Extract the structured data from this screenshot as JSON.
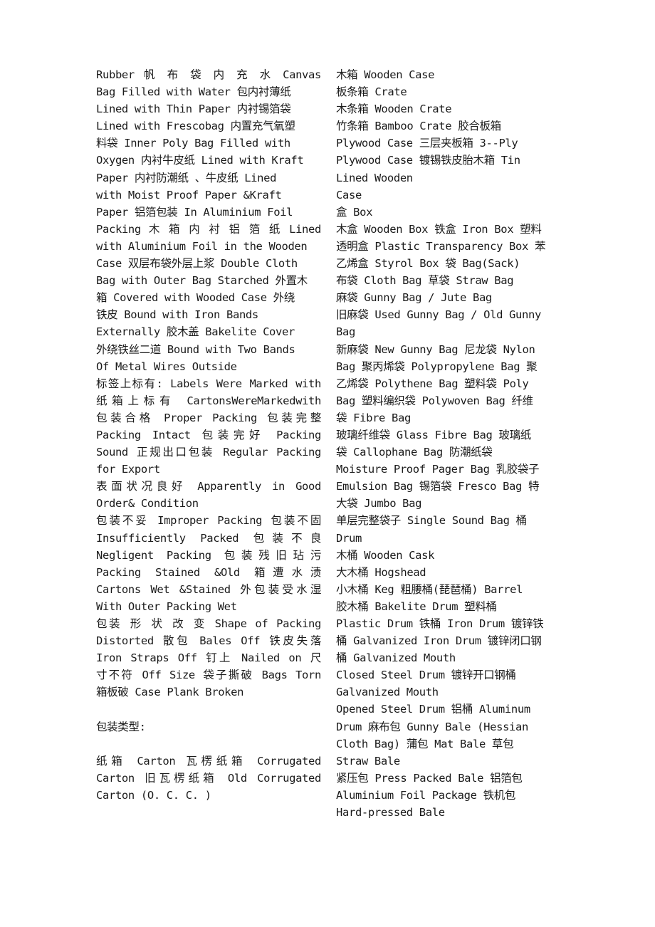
{
  "document": {
    "left_column": {
      "paragraphs": [
        {
          "lines": [
            {
              "text": "Rubber 帆 布 袋 内 充 水 Canvas",
              "justify": true
            },
            {
              "text": "Bag Filled with Water 包内衬薄纸",
              "justify": false
            },
            {
              "text": "Lined with Thin Paper 内衬锡箔袋",
              "justify": false
            },
            {
              "text": "Lined with Frescobag 内置充气氧塑",
              "justify": false
            },
            {
              "text": "料袋 Inner Poly Bag Filled with",
              "justify": false
            },
            {
              "text": "Oxygen 内衬牛皮纸 Lined with Kraft",
              "justify": false
            },
            {
              "text": "Paper 内衬防潮纸 、牛皮纸 Lined",
              "justify": false
            },
            {
              "text": "with Moist Proof Paper &Kraft",
              "justify": false
            },
            {
              "text": "Paper 铝箔包装 In Aluminium Foil",
              "justify": false
            },
            {
              "text": "Packing 木 箱 内 衬 铝 箔 纸 Lined",
              "justify": true
            },
            {
              "text": "with Aluminium Foil in the Wooden",
              "justify": false
            },
            {
              "text": "Case 双层布袋外层上浆 Double Cloth",
              "justify": false
            },
            {
              "text": "Bag with Outer Bag Starched 外置木",
              "justify": false
            },
            {
              "text": "箱 Covered with Wooded Case 外绕",
              "justify": false
            },
            {
              "text": "铁皮 Bound with Iron Bands",
              "justify": false
            },
            {
              "text": "Externally 胶木盖 Bakelite Cover",
              "justify": false
            },
            {
              "text": "外绕铁丝二道 Bound with Two Bands",
              "justify": false
            },
            {
              "text": "Of Metal Wires Outside",
              "justify": false
            }
          ]
        },
        {
          "lines": [
            {
              "text": "标签上标有: Labels Were Marked with",
              "justify": true
            },
            {
              "text": "纸箱上标有 CartonsWereMarkedwith",
              "justify": true
            },
            {
              "text": "包装合格 Proper Packing 包装完整",
              "justify": true
            },
            {
              "text": "Packing Intact 包装完好 Packing",
              "justify": true
            },
            {
              "text": "Sound 正规出口包装 Regular Packing",
              "justify": true
            },
            {
              "text": "for Export",
              "justify": false
            }
          ]
        },
        {
          "lines": [
            {
              "text": "表面状况良好 Apparently in Good",
              "justify": true
            },
            {
              "text": "Order& Condition",
              "justify": false
            }
          ]
        },
        {
          "lines": [
            {
              "text": "包装不妥 Improper Packing 包装不固",
              "justify": true
            },
            {
              "text": "Insufficiently Packed 包装不良",
              "justify": true
            },
            {
              "text": "Negligent Packing 包装残旧玷污",
              "justify": true
            },
            {
              "text": "Packing Stained &Old 箱遭水渍",
              "justify": true
            },
            {
              "text": "Cartons Wet &Stained 外包装受水湿",
              "justify": true
            },
            {
              "text": "With Outer Packing Wet",
              "justify": false
            }
          ]
        },
        {
          "lines": [
            {
              "text": "包装 形 状 改 变 Shape of Packing",
              "justify": true
            },
            {
              "text": "Distorted 散包 Bales Off 铁皮失落",
              "justify": true
            },
            {
              "text": "Iron Straps Off 钉上 Nailed on 尺",
              "justify": true
            },
            {
              "text": "寸不符 Off Size 袋子撕破 Bags Torn",
              "justify": true
            },
            {
              "text": "箱板破 Case Plank Broken",
              "justify": false
            }
          ]
        }
      ],
      "section_heading": "包装类型:",
      "after_heading": {
        "lines": [
          {
            "text": "纸箱 Carton 瓦楞纸箱 Corrugated",
            "justify": true
          },
          {
            "text": "Carton 旧瓦楞纸箱 Old Corrugated",
            "justify": true
          },
          {
            "text": "Carton (O. C. C. )",
            "justify": false
          }
        ]
      }
    },
    "right_column": {
      "lines": [
        {
          "text": "木箱 Wooden Case",
          "justify": false
        },
        {
          "text": "板条箱 Crate",
          "justify": false
        },
        {
          "text": "木条箱 Wooden Crate",
          "justify": false
        },
        {
          "text": "竹条箱 Bamboo Crate 胶合板箱",
          "justify": false
        },
        {
          "text": "Plywood Case 三层夹板箱 3--Ply",
          "justify": false
        },
        {
          "text": "Plywood Case 镀锡铁皮胎木箱 Tin",
          "justify": false
        },
        {
          "text": "Lined Wooden",
          "justify": false
        },
        {
          "text": "Case",
          "justify": false
        },
        {
          "text": "盒 Box",
          "justify": false
        },
        {
          "text": "木盒 Wooden Box 铁盒 Iron Box 塑料",
          "justify": false
        },
        {
          "text": "透明盒 Plastic Transparency Box 苯",
          "justify": false
        },
        {
          "text": "乙烯盒 Styrol Box 袋 Bag(Sack)",
          "justify": false
        },
        {
          "text": "布袋 Cloth Bag 草袋 Straw Bag",
          "justify": false
        },
        {
          "text": "麻袋 Gunny Bag / Jute Bag",
          "justify": false
        },
        {
          "text": "旧麻袋 Used Gunny Bag / Old Gunny",
          "justify": false
        },
        {
          "text": "Bag",
          "justify": false
        },
        {
          "text": "新麻袋 New Gunny Bag 尼龙袋 Nylon",
          "justify": false
        },
        {
          "text": "Bag 聚丙烯袋 Polypropylene Bag 聚",
          "justify": false
        },
        {
          "text": "乙烯袋 Polythene Bag 塑料袋 Poly",
          "justify": false
        },
        {
          "text": "Bag 塑料编织袋 Polywoven Bag 纤维",
          "justify": false
        },
        {
          "text": "袋 Fibre Bag",
          "justify": false
        },
        {
          "text": "玻璃纤维袋 Glass Fibre Bag 玻璃纸",
          "justify": false
        },
        {
          "text": "袋 Callophane Bag 防潮纸袋",
          "justify": false
        },
        {
          "text": "Moisture Proof Pager Bag 乳胶袋子",
          "justify": false
        },
        {
          "text": "Emulsion Bag 锡箔袋 Fresco Bag 特",
          "justify": false
        },
        {
          "text": "大袋 Jumbo Bag",
          "justify": false
        },
        {
          "text": "单层完整袋子 Single Sound Bag 桶",
          "justify": false
        },
        {
          "text": "Drum",
          "justify": false
        },
        {
          "text": "木桶 Wooden Cask",
          "justify": false
        },
        {
          "text": "大木桶 Hogshead",
          "justify": false
        },
        {
          "text": "小木桶 Keg 粗腰桶(琵琶桶) Barrel",
          "justify": false
        },
        {
          "text": "胶木桶 Bakelite Drum 塑料桶",
          "justify": false
        },
        {
          "text": "Plastic Drum 铁桶 Iron Drum 镀锌铁",
          "justify": false
        },
        {
          "text": "桶 Galvanized Iron Drum 镀锌闭口钢",
          "justify": false
        },
        {
          "text": "桶 Galvanized Mouth",
          "justify": false
        },
        {
          "text": "Closed Steel Drum 镀锌开口钢桶",
          "justify": false
        },
        {
          "text": "Galvanized Mouth",
          "justify": false
        },
        {
          "text": "Opened Steel Drum 铝桶 Aluminum",
          "justify": false
        },
        {
          "text": "Drum 麻布包 Gunny Bale (Hessian",
          "justify": false
        },
        {
          "text": "Cloth Bag) 蒲包 Mat Bale 草包",
          "justify": false
        },
        {
          "text": "Straw Bale",
          "justify": false
        },
        {
          "text": "紧压包 Press Packed Bale 铝箔包",
          "justify": false
        },
        {
          "text": "Aluminium Foil Package 铁机包",
          "justify": false
        },
        {
          "text": "Hard-pressed Bale",
          "justify": false
        }
      ]
    }
  }
}
